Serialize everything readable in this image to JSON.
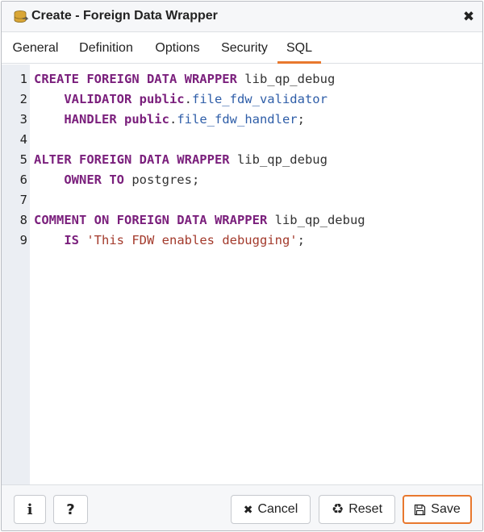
{
  "dialog": {
    "title": "Create - Foreign Data Wrapper",
    "title_icon": "foreign-data-wrapper-icon",
    "close_icon": "close-icon"
  },
  "tabs": [
    {
      "label": "General",
      "active": false
    },
    {
      "label": "Definition",
      "active": false
    },
    {
      "label": "Options",
      "active": false
    },
    {
      "label": "Security",
      "active": false
    },
    {
      "label": "SQL",
      "active": true
    }
  ],
  "sql_editor": {
    "lines": [
      {
        "number": "1",
        "tokens": [
          {
            "text": "CREATE FOREIGN DATA WRAPPER",
            "type": "kw"
          },
          {
            "text": " lib_qp_debug",
            "type": "id"
          }
        ]
      },
      {
        "number": "2",
        "tokens": [
          {
            "text": "    ",
            "type": "id"
          },
          {
            "text": "VALIDATOR public",
            "type": "kw"
          },
          {
            "text": ".",
            "type": "punct"
          },
          {
            "text": "file_fdw_validator",
            "type": "fn"
          }
        ]
      },
      {
        "number": "3",
        "tokens": [
          {
            "text": "    ",
            "type": "id"
          },
          {
            "text": "HANDLER public",
            "type": "kw"
          },
          {
            "text": ".",
            "type": "punct"
          },
          {
            "text": "file_fdw_handler",
            "type": "fn"
          },
          {
            "text": ";",
            "type": "punct"
          }
        ]
      },
      {
        "number": "4",
        "tokens": []
      },
      {
        "number": "5",
        "tokens": [
          {
            "text": "ALTER FOREIGN DATA WRAPPER",
            "type": "kw"
          },
          {
            "text": " lib_qp_debug",
            "type": "id"
          }
        ]
      },
      {
        "number": "6",
        "tokens": [
          {
            "text": "    ",
            "type": "id"
          },
          {
            "text": "OWNER TO",
            "type": "kw"
          },
          {
            "text": " postgres;",
            "type": "id"
          }
        ]
      },
      {
        "number": "7",
        "tokens": []
      },
      {
        "number": "8",
        "tokens": [
          {
            "text": "COMMENT ON FOREIGN DATA WRAPPER",
            "type": "kw"
          },
          {
            "text": " lib_qp_debug",
            "type": "id"
          }
        ]
      },
      {
        "number": "9",
        "tokens": [
          {
            "text": "    ",
            "type": "id"
          },
          {
            "text": "IS",
            "type": "kw"
          },
          {
            "text": " ",
            "type": "id"
          },
          {
            "text": "'This FDW enables debugging'",
            "type": "str"
          },
          {
            "text": ";",
            "type": "punct"
          }
        ]
      }
    ]
  },
  "footer": {
    "info_label": "i",
    "help_label": "?",
    "cancel_label": "Cancel",
    "reset_label": "Reset",
    "save_label": "Save"
  },
  "colors": {
    "accent": "#e8782e",
    "keyword": "#7a1f7c",
    "function": "#2f5ea8",
    "string": "#a33a2c"
  }
}
